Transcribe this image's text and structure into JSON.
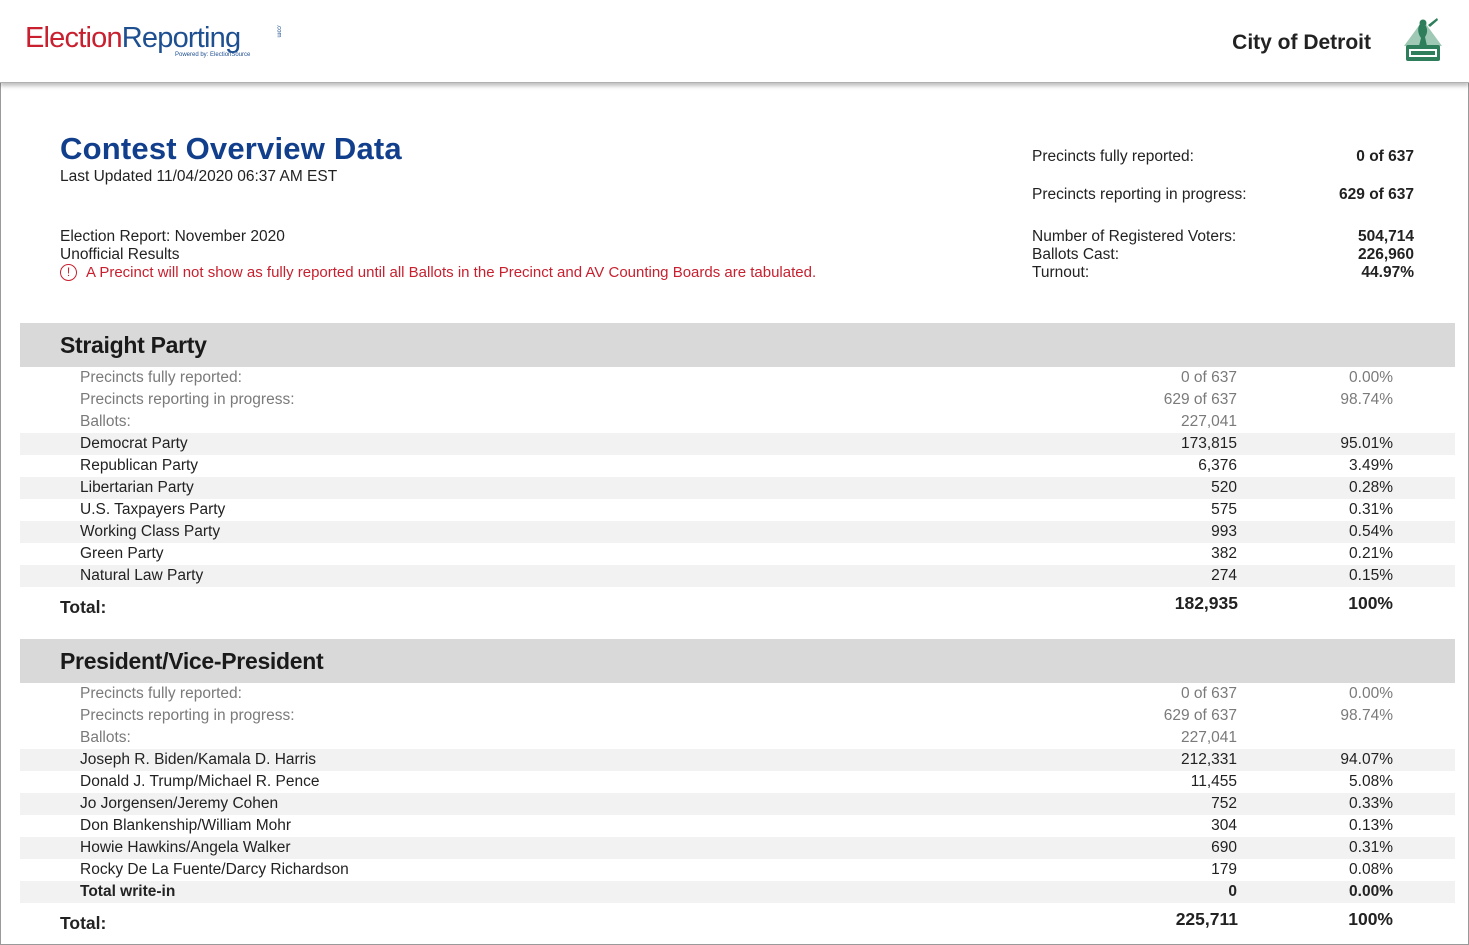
{
  "header": {
    "logo_election": "Election",
    "logo_reporting": "Reporting",
    "logo_powered": "Powered by: ElectionSource",
    "logo_com": ".com",
    "city": "City of Detroit"
  },
  "overview": {
    "title": "Contest Overview Data",
    "last_updated": "Last Updated 11/04/2020 06:37 AM EST",
    "election_report": "Election Report: November 2020",
    "results_status": "Unofficial Results",
    "notice": "A Precinct will not show as fully reported until all Ballots in the Precinct and AV Counting Boards are tabulated.",
    "stats": [
      {
        "label": "Precincts fully reported:",
        "value": "0 of 637"
      },
      {
        "label": "Precincts reporting in progress:",
        "value": "629 of 637"
      },
      {
        "label": "Number of Registered Voters:",
        "value": "504,714"
      },
      {
        "label": "Ballots Cast:",
        "value": "226,960"
      },
      {
        "label": "Turnout:",
        "value": "44.97%"
      }
    ]
  },
  "sections": [
    {
      "title": "Straight Party",
      "meta": [
        {
          "name": "Precincts fully reported:",
          "votes": "0 of 637",
          "pct": "0.00%"
        },
        {
          "name": "Precincts reporting in progress:",
          "votes": "629 of 637",
          "pct": "98.74%"
        },
        {
          "name": "Ballots:",
          "votes": "227,041",
          "pct": ""
        }
      ],
      "rows": [
        {
          "name": "Democrat Party",
          "votes": "173,815",
          "pct": "95.01%"
        },
        {
          "name": "Republican Party",
          "votes": "6,376",
          "pct": "3.49%"
        },
        {
          "name": "Libertarian Party",
          "votes": "520",
          "pct": "0.28%"
        },
        {
          "name": "U.S. Taxpayers Party",
          "votes": "575",
          "pct": "0.31%"
        },
        {
          "name": "Working Class Party",
          "votes": "993",
          "pct": "0.54%"
        },
        {
          "name": "Green Party",
          "votes": "382",
          "pct": "0.21%"
        },
        {
          "name": "Natural Law Party",
          "votes": "274",
          "pct": "0.15%"
        }
      ],
      "total": {
        "label": "Total:",
        "votes": "182,935",
        "pct": "100%"
      }
    },
    {
      "title": "President/Vice-President",
      "meta": [
        {
          "name": "Precincts fully reported:",
          "votes": "0 of 637",
          "pct": "0.00%"
        },
        {
          "name": "Precincts reporting in progress:",
          "votes": "629 of 637",
          "pct": "98.74%"
        },
        {
          "name": "Ballots:",
          "votes": "227,041",
          "pct": ""
        }
      ],
      "rows": [
        {
          "name": "Joseph R. Biden/Kamala D. Harris",
          "votes": "212,331",
          "pct": "94.07%"
        },
        {
          "name": "Donald J. Trump/Michael R. Pence",
          "votes": "11,455",
          "pct": "5.08%"
        },
        {
          "name": "Jo Jorgensen/Jeremy Cohen",
          "votes": "752",
          "pct": "0.33%"
        },
        {
          "name": "Don Blankenship/William Mohr",
          "votes": "304",
          "pct": "0.13%"
        },
        {
          "name": "Howie Hawkins/Angela Walker",
          "votes": "690",
          "pct": "0.31%"
        },
        {
          "name": "Rocky De La Fuente/Darcy Richardson",
          "votes": "179",
          "pct": "0.08%"
        },
        {
          "name": "Total write-in",
          "votes": "0",
          "pct": "0.00%"
        }
      ],
      "total": {
        "label": "Total:",
        "votes": "225,711",
        "pct": "100%"
      }
    }
  ],
  "colors": {
    "brand_red": "#c8202f",
    "brand_blue": "#1d4f91",
    "title_blue": "#123f8c",
    "section_header_bg": "#d9d9d9",
    "row_shade": "#f2f2f2",
    "seal_green": "#2e7d5b"
  }
}
